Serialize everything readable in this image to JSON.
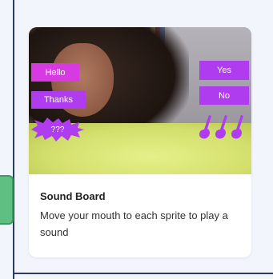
{
  "card": {
    "title": "Sound Board",
    "description": "Move your mouth to each sprite to play a sound",
    "sprites": {
      "hello": "Hello",
      "thanks": "Thanks",
      "burst": "???",
      "yes": "Yes",
      "no": "No"
    },
    "icons": {
      "guitars": "guitar-icon"
    }
  },
  "colors": {
    "sprite_purple": "#b03cf0",
    "sprite_pink": "#d63ae0",
    "side_tab_green": "#5fbf83",
    "frame_navy": "#2a3b66"
  }
}
